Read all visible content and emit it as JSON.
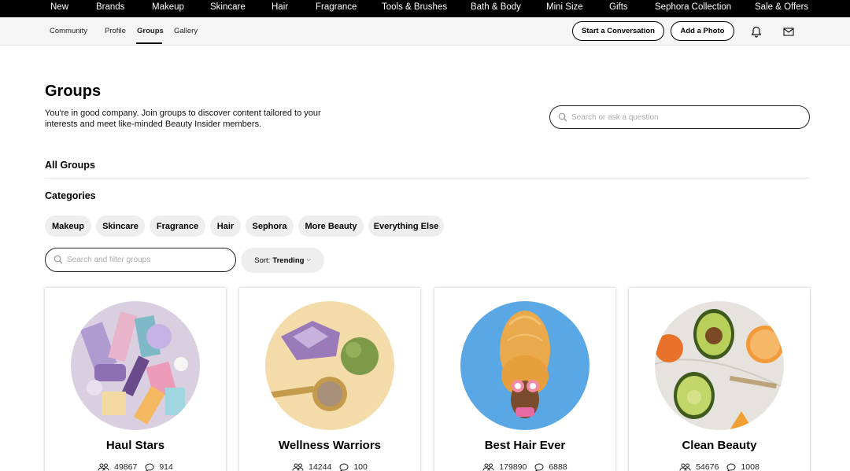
{
  "top_nav": [
    "New",
    "Brands",
    "Makeup",
    "Skincare",
    "Hair",
    "Fragrance",
    "Tools & Brushes",
    "Bath & Body",
    "Mini Size",
    "Gifts",
    "Sephora Collection",
    "Sale & Offers"
  ],
  "sub_nav": {
    "tabs": [
      "Community",
      "Profile",
      "Groups",
      "Gallery"
    ],
    "active_tab": "Groups",
    "start_conversation_label": "Start a Conversation",
    "add_photo_label": "Add a Photo",
    "icons": [
      "bell-icon",
      "mail-icon"
    ]
  },
  "page": {
    "title": "Groups",
    "intro": "You're in good company. Join groups to discover content tailored to your interests and meet like-minded Beauty Insider members.",
    "ask_placeholder": "Search or ask a question",
    "all_groups_label": "All Groups",
    "categories_label": "Categories",
    "categories": [
      "Makeup",
      "Skincare",
      "Fragrance",
      "Hair",
      "Sephora",
      "More Beauty",
      "Everything Else"
    ],
    "filter_placeholder": "Search and filter groups",
    "sort_prefix": "Sort:",
    "sort_value": "Trending"
  },
  "groups": [
    {
      "name": "Haul Stars",
      "members": "49867",
      "posts": "914"
    },
    {
      "name": "Wellness Warriors",
      "members": "14244",
      "posts": "100"
    },
    {
      "name": "Best Hair Ever",
      "members": "179890",
      "posts": "6888"
    },
    {
      "name": "Clean Beauty",
      "members": "54676",
      "posts": "1008"
    }
  ],
  "colors": {
    "nav_bg": "#000000",
    "subnav_bg": "#f5f5f5",
    "chip_bg": "#eeeeee"
  }
}
